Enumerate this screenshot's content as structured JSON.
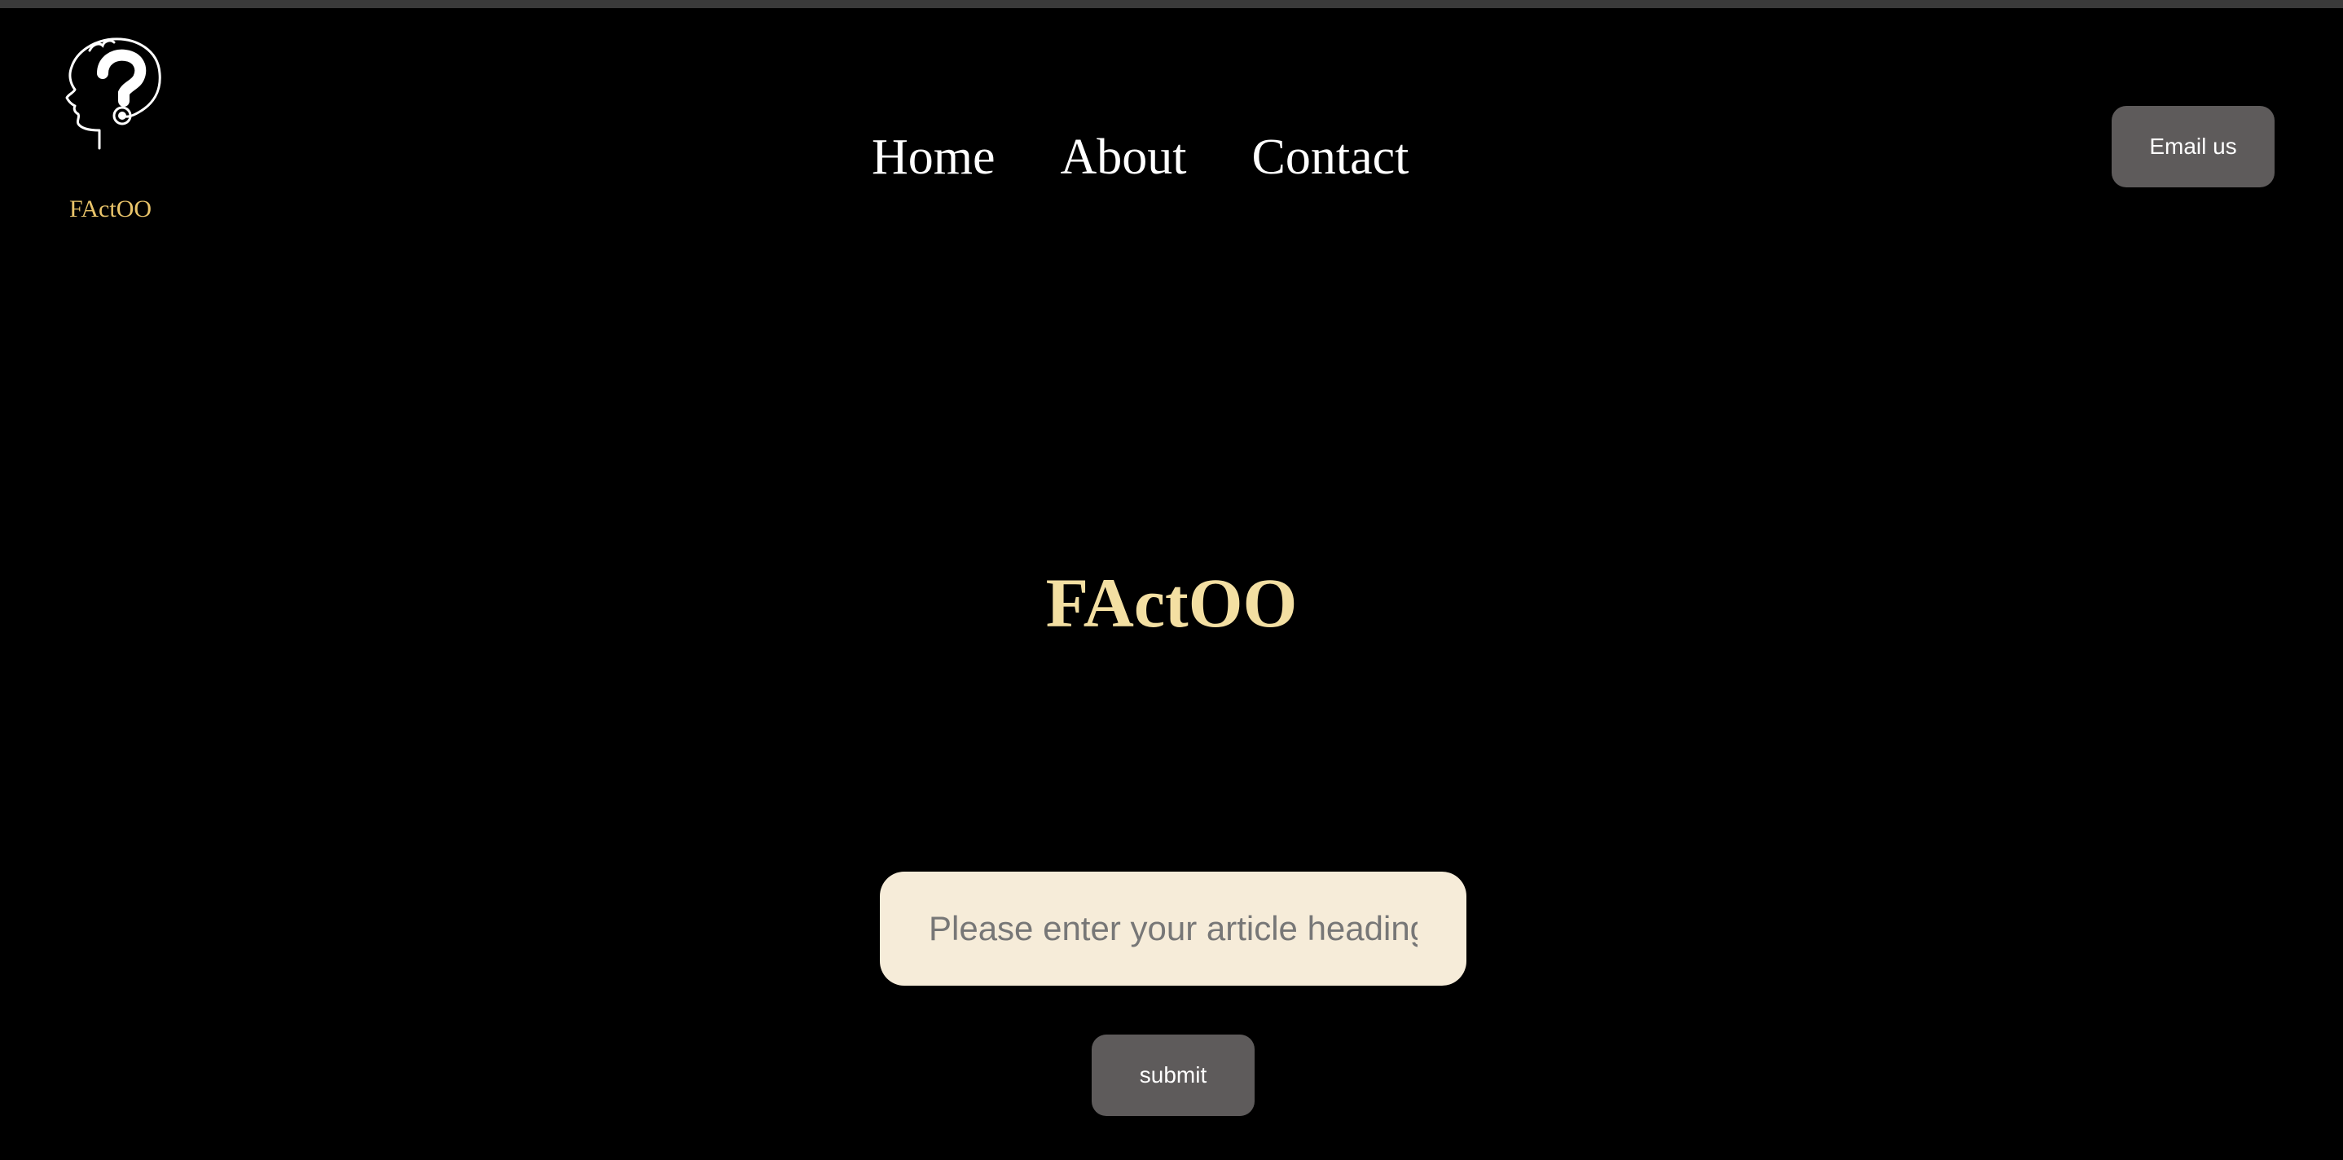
{
  "header": {
    "logo_text": "FActOO",
    "logo_icon": "head-question-mark-icon",
    "nav": [
      {
        "label": "Home"
      },
      {
        "label": "About"
      },
      {
        "label": "Contact"
      }
    ],
    "email_button_label": "Email us"
  },
  "hero": {
    "title": "FActOO"
  },
  "form": {
    "input_value": "",
    "input_placeholder": "Please enter your article heading to check",
    "submit_label": "submit"
  },
  "colors": {
    "background": "#000000",
    "logo_text": "#e9c46a",
    "hero_title": "#f3dfa2",
    "button_bg": "#5e5b5b",
    "input_bg": "#f6ecd9"
  }
}
